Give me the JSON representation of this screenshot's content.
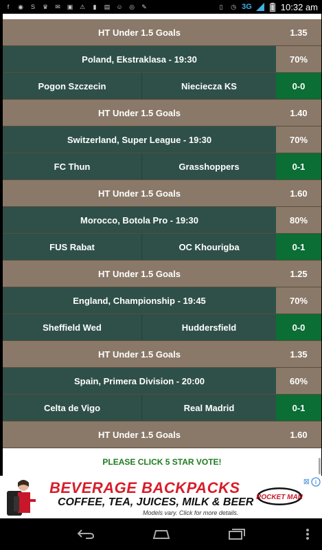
{
  "status_bar": {
    "network": "3G",
    "time": "10:32 am",
    "left_icons": [
      "facebook-icon",
      "whatsapp-icon",
      "skype-icon",
      "crown-icon",
      "mail-icon",
      "image-icon",
      "warning-icon",
      "battery-icon",
      "store-icon",
      "cat-icon",
      "chrome-icon",
      "scribble-icon"
    ],
    "right_icons": [
      "vibrate-icon",
      "alarm-icon",
      "signal-icon",
      "battery-icon"
    ]
  },
  "rows": [
    {
      "type": "tip",
      "label": "HT Under 1.5 Goals",
      "value": "1.35"
    },
    {
      "type": "league",
      "label": "Poland, Ekstraklasa - 19:30",
      "value": "70%"
    },
    {
      "type": "match",
      "home": "Pogon Szczecin",
      "away": "Nieciecza KS",
      "value": "0-0"
    },
    {
      "type": "tip",
      "label": "HT Under 1.5 Goals",
      "value": "1.40"
    },
    {
      "type": "league",
      "label": "Switzerland, Super League - 19:30",
      "value": "70%"
    },
    {
      "type": "match",
      "home": "FC Thun",
      "away": "Grasshoppers",
      "value": "0-1"
    },
    {
      "type": "tip",
      "label": "HT Under 1.5 Goals",
      "value": "1.60"
    },
    {
      "type": "league",
      "label": "Morocco, Botola Pro - 19:30",
      "value": "80%"
    },
    {
      "type": "match",
      "home": "FUS Rabat",
      "away": "OC Khourigba",
      "value": "0-1"
    },
    {
      "type": "tip",
      "label": "HT Under 1.5 Goals",
      "value": "1.25"
    },
    {
      "type": "league",
      "label": "England, Championship - 19:45",
      "value": "70%"
    },
    {
      "type": "match",
      "home": "Sheffield Wed",
      "away": "Huddersfield",
      "value": "0-0"
    },
    {
      "type": "tip",
      "label": "HT Under 1.5 Goals",
      "value": "1.35"
    },
    {
      "type": "league",
      "label": "Spain, Primera Division - 20:00",
      "value": "60%"
    },
    {
      "type": "match",
      "home": "Celta de Vigo",
      "away": "Real Madrid",
      "value": "0-1"
    },
    {
      "type": "tip",
      "label": "HT Under 1.5 Goals",
      "value": "1.60"
    }
  ],
  "vote_label": "PLEASE CLICK 5 STAR VOTE!",
  "ad": {
    "headline": "BEVERAGE BACKPACKS",
    "subline": "COFFEE, TEA, JUICES, MILK & BEER",
    "fine_print": "Models vary. Click for more details.",
    "brand": "ROCKET MAN"
  },
  "colors": {
    "tip_bg": "#8a7968",
    "league_bg": "#2e5048",
    "score_bg": "#0b6e34",
    "vote_text": "#1e7a1e",
    "ad_headline": "#d81d2a"
  }
}
